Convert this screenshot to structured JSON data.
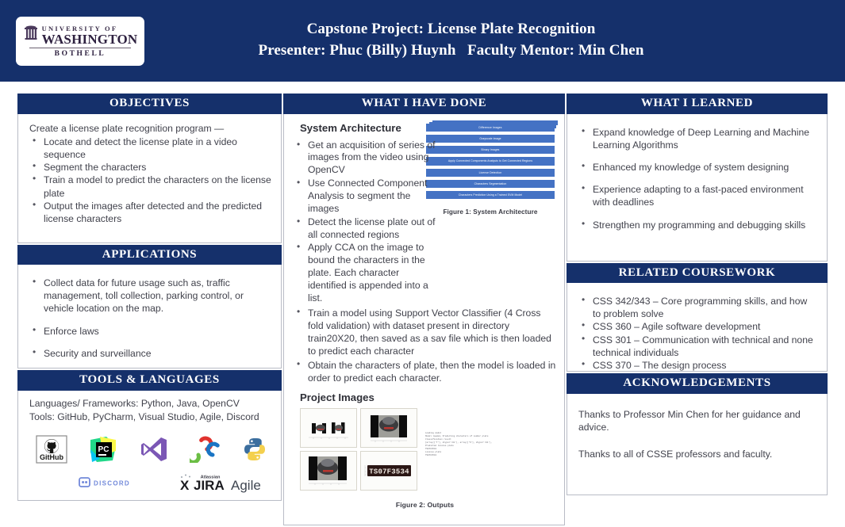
{
  "header": {
    "logo": {
      "university": "UNIVERSITY OF",
      "name": "WASHINGTON",
      "campus": "BOTHELL"
    },
    "title_line1": "Capstone Project: License Plate Recognition",
    "title_line2": "Presenter: Phuc (Billy) Huynh   Faculty Mentor: Min Chen"
  },
  "colors": {
    "navy": "#15306b",
    "flow_blue": "#4472c4",
    "border": "#b9bcc6",
    "body_text": "#41424c"
  },
  "objectives": {
    "heading": "OBJECTIVES",
    "lead": "Create a license plate recognition program —",
    "bullets": [
      "Locate and detect the license plate in a video sequence",
      "Segment the characters",
      "Train a model to predict the characters on the license plate",
      "Output the images after detected and the predicted license characters"
    ]
  },
  "applications": {
    "heading": "APPLICATIONS",
    "bullets": [
      "Collect data for future usage such as, traffic management, toll collection, parking control, or vehicle location on the map.",
      "Enforce laws",
      "Security and surveillance"
    ]
  },
  "tools": {
    "heading": "TOOLS & LANGUAGES",
    "languages_line": "Languages/ Frameworks: Python, Java, OpenCV",
    "tools_line": "Tools: GitHub, PyCharm, Visual Studio, Agile, Discord",
    "logos_row1": [
      "github-logo",
      "pycharm-logo",
      "visual-studio-logo",
      "opencv-logo",
      "python-logo"
    ],
    "logos_row2": [
      "discord-logo",
      "jira-agile-logo"
    ],
    "github_label": "GitHub",
    "pycharm_label": "PC",
    "discord_label": "DISCORD",
    "jira_label": "JIRA",
    "jira_sub": "Atlassian",
    "agile_label": "Agile"
  },
  "done": {
    "heading": "WHAT I HAVE DONE",
    "architecture_title": "System Architecture",
    "bullets_narrow": [
      "Get  an acquisition of series of images from the video using OpenCV",
      "Use Connected Component Analysis to segment the images",
      "Detect the license plate out of all connected regions",
      "Apply CCA on the image to bound the characters in the plate. Each character identified is appended into a list."
    ],
    "bullets_wide": [
      "Train a model using Support Vector Classifier (4 Cross fold validation) with dataset present in directory train20X20, then saved as a sav file which is then loaded to predict each character",
      "Obtain the characters of plate, then the model is loaded in order to predict each character."
    ],
    "flow_boxes": [
      "Difference Images",
      "Grayscale Image",
      "Binary Images",
      "Apply Connected Components Analysis to Get Connected Regions",
      "License Detection",
      "Characters Segmentation",
      "Characters Prediction Using a Trained SVM Model"
    ],
    "figure1_caption": "Figure 1:  System Architecture",
    "project_images_title": "Project Images",
    "console_output": "Loading model\nModel loaded, Predicting characters of number plate\nClassification result\n[array(['T'], dtype='<U1'), array(['S'], dtype='<U1'),\nPredicted license plate\nTS07F3534\nLicense plate\nTS07F3534",
    "plate_text": "TS07F3534",
    "figure2_caption": "Figure 2:  Outputs"
  },
  "learned": {
    "heading": "WHAT I LEARNED",
    "bullets": [
      "Expand knowledge of Deep Learning and Machine Learning Algorithms",
      "Enhanced my knowledge of system designing",
      "Experience adapting to a fast-paced environment with deadlines",
      "Strengthen my programming and  debugging skills"
    ]
  },
  "coursework": {
    "heading": "RELATED COURSEWORK",
    "bullets": [
      "CSS 342/343 – Core programming skills, and how to problem solve",
      "CSS 360 – Agile software development",
      "CSS 301 – Communication with technical and none technical individuals",
      "CSS 370 – The design process"
    ]
  },
  "acknowledgements": {
    "heading": "ACKNOWLEDGEMENTS",
    "paragraph1": "Thanks to Professor Min Chen for her guidance and advice.",
    "paragraph2": "Thanks to all of CSSE professors and faculty."
  }
}
